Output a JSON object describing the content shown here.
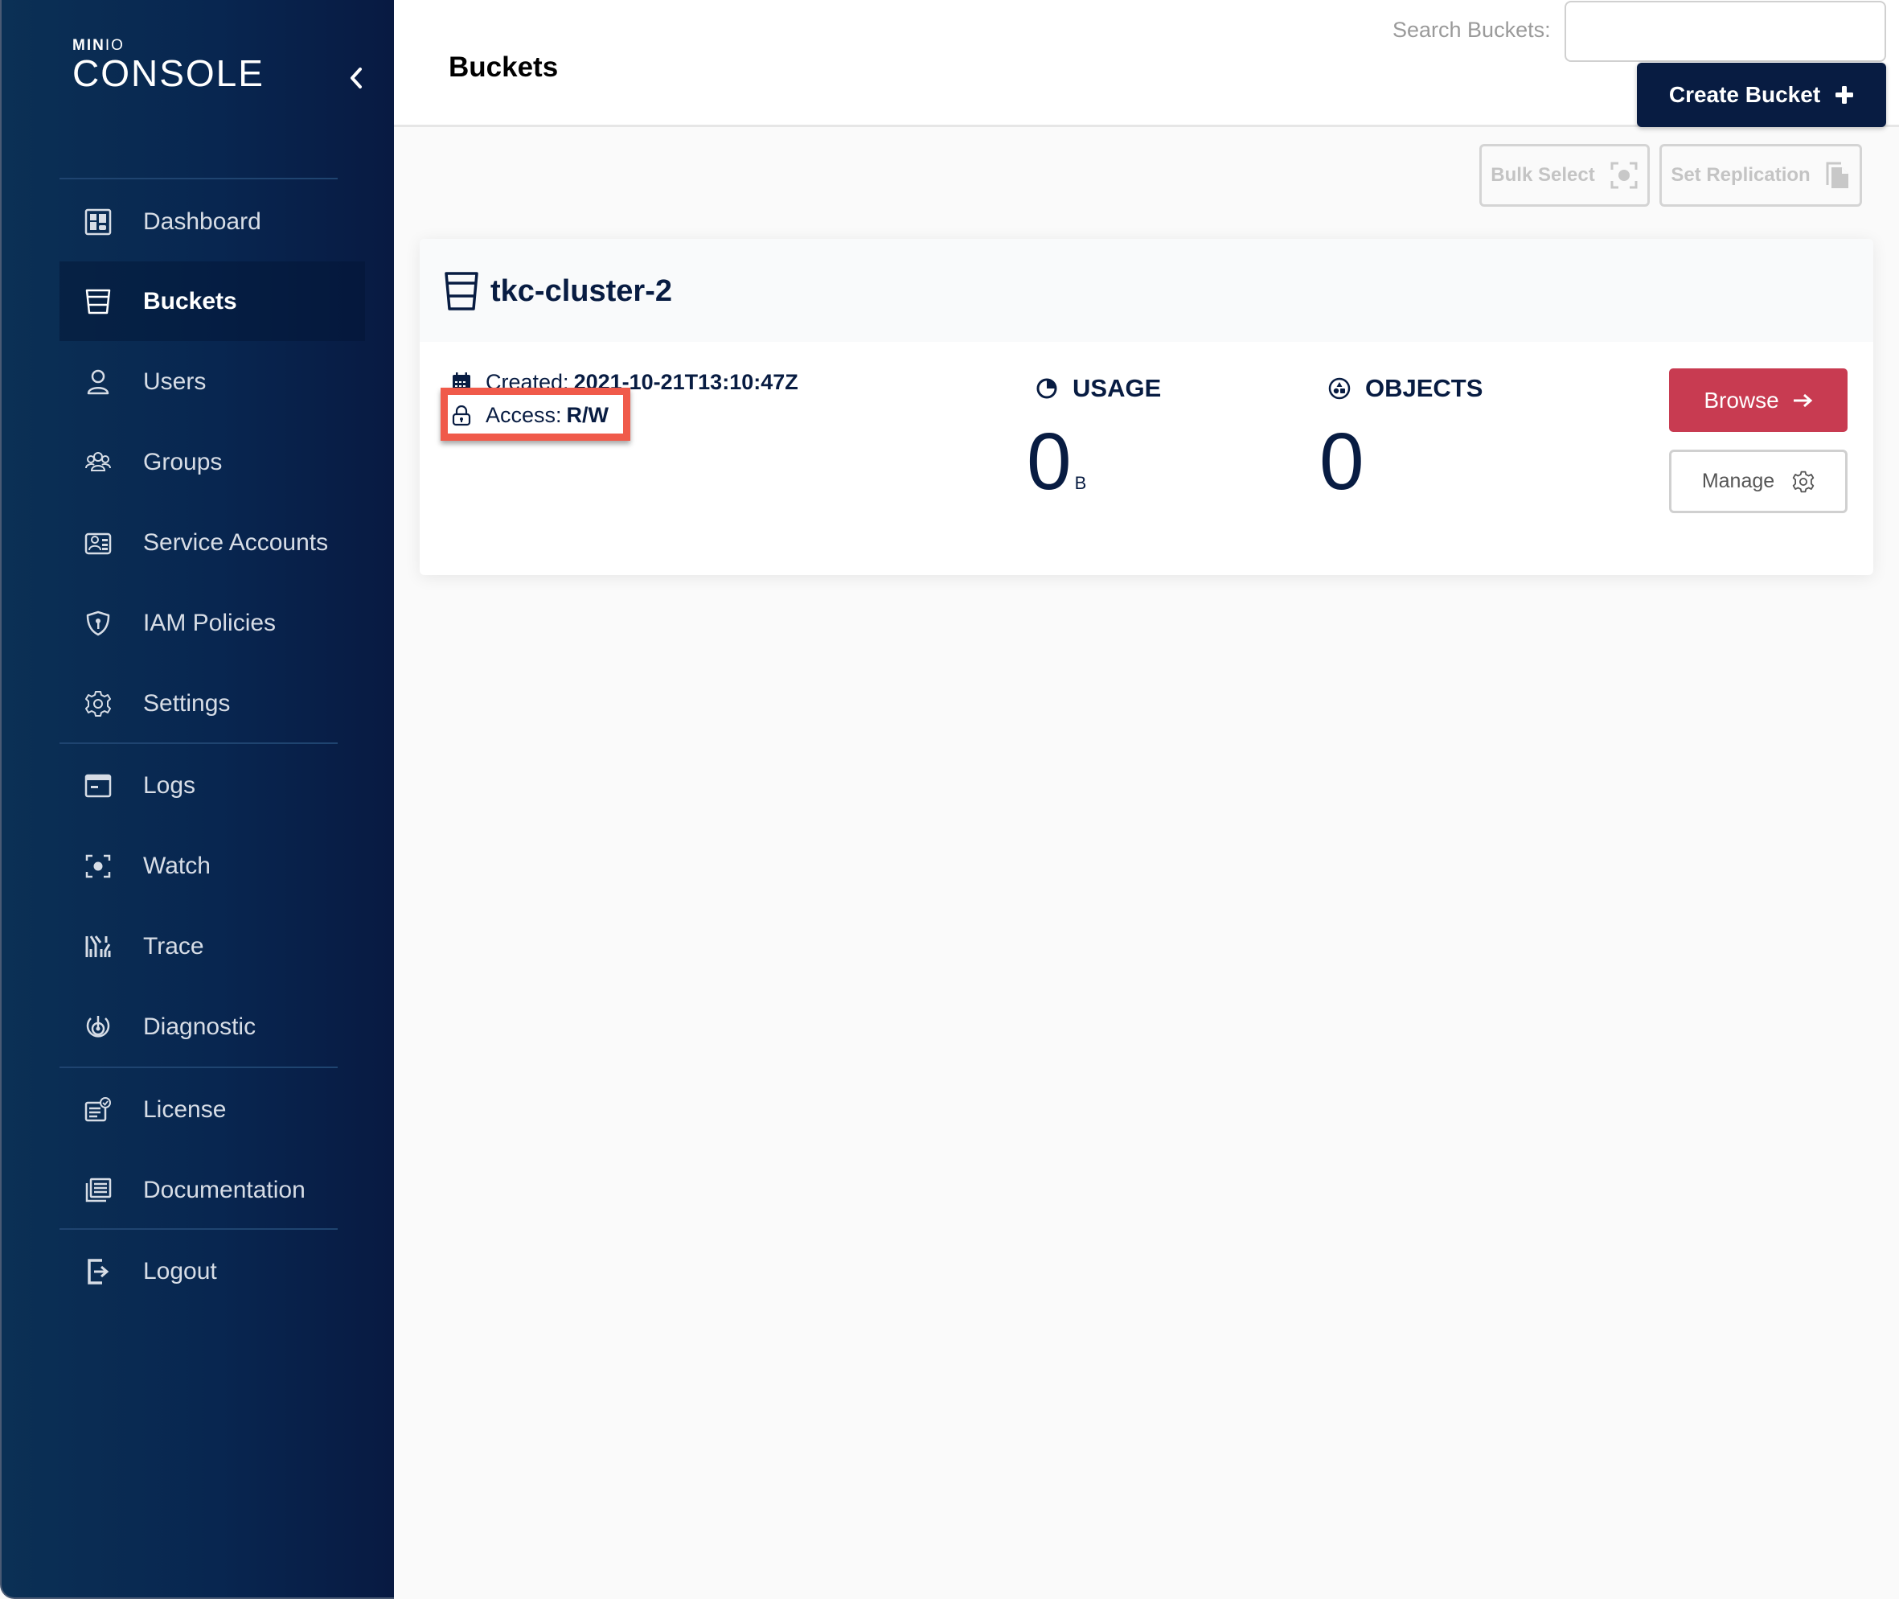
{
  "sidebar": {
    "logo_top": "MIN",
    "logo_top_io": "IO",
    "logo_bottom": "CONSOLE",
    "items": [
      {
        "label": "Dashboard",
        "icon": "dashboard-icon"
      },
      {
        "label": "Buckets",
        "icon": "bucket-icon",
        "active": true
      },
      {
        "label": "Users",
        "icon": "user-icon"
      },
      {
        "label": "Groups",
        "icon": "groups-icon"
      },
      {
        "label": "Service Accounts",
        "icon": "service-accounts-icon"
      },
      {
        "label": "IAM Policies",
        "icon": "shield-key-icon"
      },
      {
        "label": "Settings",
        "icon": "gear-icon"
      },
      {
        "label": "Logs",
        "icon": "logs-icon"
      },
      {
        "label": "Watch",
        "icon": "watch-icon"
      },
      {
        "label": "Trace",
        "icon": "trace-icon"
      },
      {
        "label": "Diagnostic",
        "icon": "diagnostic-icon"
      },
      {
        "label": "License",
        "icon": "license-icon"
      },
      {
        "label": "Documentation",
        "icon": "documentation-icon"
      },
      {
        "label": "Logout",
        "icon": "logout-icon"
      }
    ]
  },
  "header": {
    "title": "Buckets",
    "search_label": "Search Buckets:",
    "search_value": "",
    "create_bucket_label": "Create Bucket"
  },
  "toolbar": {
    "bulk_select_label": "Bulk Select",
    "set_replication_label": "Set Replication"
  },
  "buckets": [
    {
      "name": "tkc-cluster-2",
      "created_label": "Created:",
      "created_value": "2021-10-21T13:10:47Z",
      "access_label": "Access:",
      "access_value": "R/W",
      "usage_label": "USAGE",
      "usage_value": "0",
      "usage_unit": "B",
      "objects_label": "OBJECTS",
      "objects_value": "0",
      "browse_label": "Browse",
      "manage_label": "Manage"
    }
  ],
  "colors": {
    "sidebar_bg": "#081c42",
    "primary": "#081c42",
    "browse": "#c83b51",
    "highlight": "#f05a4a"
  }
}
